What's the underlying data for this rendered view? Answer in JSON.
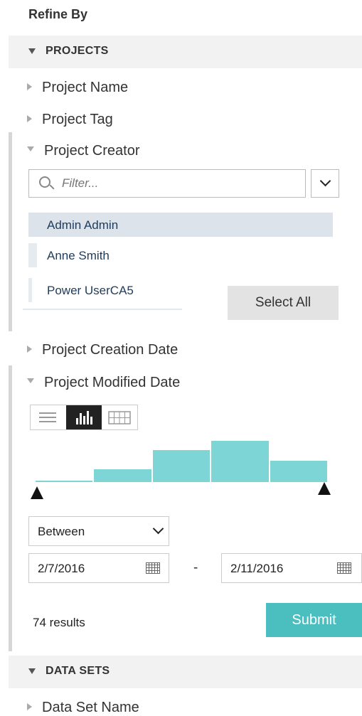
{
  "panel": {
    "title": "Refine By"
  },
  "sections": {
    "projects": {
      "label": "PROJECTS"
    },
    "data_sets": {
      "label": "DATA SETS"
    }
  },
  "facets": {
    "project_name": "Project Name",
    "project_tag": "Project Tag",
    "project_creator": "Project Creator",
    "project_creation_date": "Project Creation Date",
    "project_modified_date": "Project Modified Date",
    "data_set_name": "Data Set Name"
  },
  "creator_filter": {
    "placeholder": "Filter...",
    "options": [
      "Admin Admin",
      "Anne Smith",
      "Power UserCA5"
    ],
    "select_all_label": "Select All"
  },
  "modified_date": {
    "view_modes": [
      "list-icon",
      "histogram-icon",
      "calendar-grid-icon"
    ],
    "active_view": "histogram-icon",
    "histogram_relative_heights": [
      0.04,
      0.31,
      0.77,
      1.0,
      0.52
    ],
    "operator": "Between",
    "from_date": "2/7/2016",
    "to_date": "2/11/2016",
    "range_separator": "-",
    "results_text": "74 results",
    "submit_label": "Submit"
  },
  "colors": {
    "accent": "#4bbfbf",
    "histogram_bar": "#7dd5d5",
    "selected_row": "#dde3ea"
  }
}
